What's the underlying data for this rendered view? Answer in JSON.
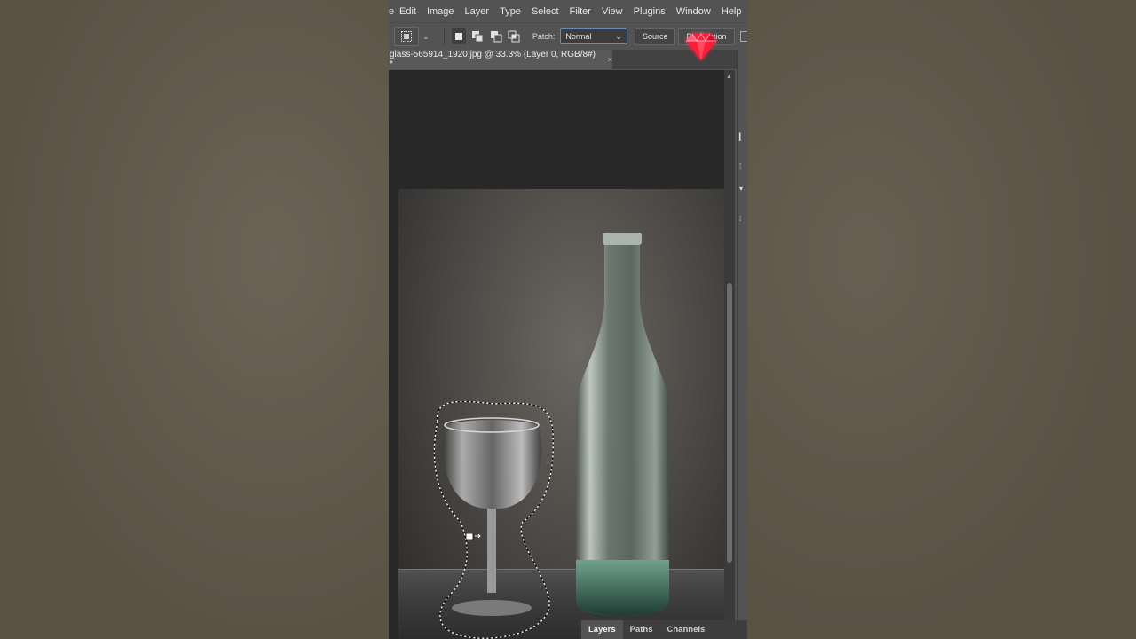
{
  "menu": [
    "e",
    "Edit",
    "Image",
    "Layer",
    "Type",
    "Select",
    "Filter",
    "View",
    "Plugins",
    "Window",
    "Help"
  ],
  "options": {
    "patch_label": "Patch:",
    "patch_value": "Normal",
    "source_label": "Source",
    "destination_label": "Destination"
  },
  "document": {
    "tab_title": "glass-565914_1920.jpg @ 33.3% (Layer 0, RGB/8#) *",
    "close_glyph": "×"
  },
  "panels": {
    "tabs": [
      "Layers",
      "Paths",
      "Channels"
    ],
    "active": "Layers"
  },
  "icons": {
    "tool_preset": "patch-tool-icon",
    "overlay": "red-gem-logo"
  },
  "colors": {
    "ui_bg": "#535353",
    "canvas_bg": "#282828",
    "accent_select": "#6a8ab5",
    "gem": "#ff1f3a"
  }
}
